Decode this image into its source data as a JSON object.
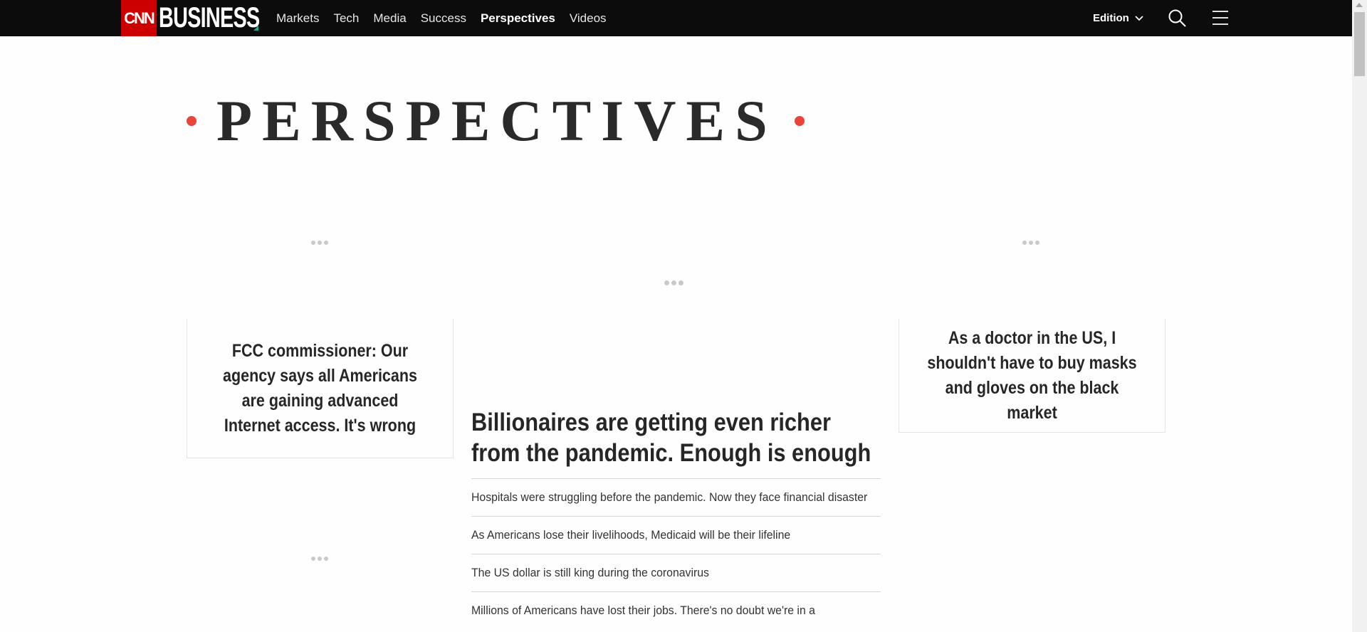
{
  "header": {
    "logo_cnn": "CNN",
    "logo_business": "BUSINESS",
    "nav": [
      {
        "label": "Markets",
        "active": false
      },
      {
        "label": "Tech",
        "active": false
      },
      {
        "label": "Media",
        "active": false
      },
      {
        "label": "Success",
        "active": false
      },
      {
        "label": "Perspectives",
        "active": true
      },
      {
        "label": "Videos",
        "active": false
      }
    ],
    "edition_label": "Edition",
    "icons": {
      "search": "search-icon",
      "menu": "hamburger-menu-icon",
      "edition": "chevron-down-icon"
    }
  },
  "section": {
    "title": "PERSPECTIVES",
    "accent_color": "#e9453a"
  },
  "cards": {
    "left_headline": "FCC commissioner: Our agency says all Americans are gaining advanced Internet access. It's wrong",
    "right_headline": "As a doctor in the US, I shouldn't have to buy masks and gloves on the black market"
  },
  "main": {
    "headline": "Billionaires are getting even richer from the pandemic. Enough is enough",
    "stories": [
      "Hospitals were struggling before the pandemic. Now they face financial disaster",
      "As Americans lose their livelihoods, Medicaid will be their lifeline",
      "The US dollar is still king during the coronavirus",
      "Millions of Americans have lost their jobs. There's no doubt we're in a"
    ]
  },
  "colors": {
    "topbar": "#0c0c0c",
    "cnn_red": "#cc0000",
    "logo_accent": "#25a88a"
  }
}
